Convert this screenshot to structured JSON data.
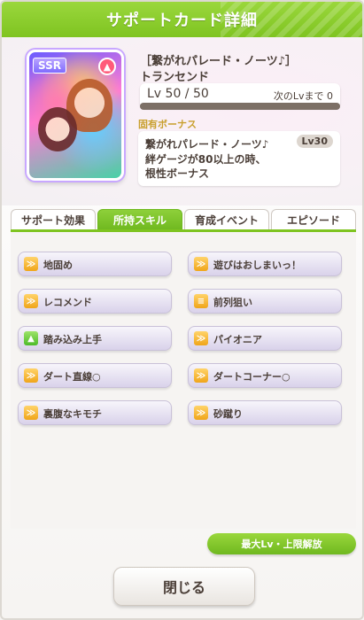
{
  "header": {
    "title": "サポートカード詳細"
  },
  "card": {
    "rarity": "SSR",
    "type_icon": "fire-icon"
  },
  "name": {
    "line1": "［繋がれパレード・ノーツ♪］",
    "line2": "トランセンド"
  },
  "level": {
    "text": "Lv 50 / 50",
    "next": "次のLvまで 0"
  },
  "bonus": {
    "label": "固有ボーナス",
    "title": "繋がれパレード・ノーツ♪",
    "lv": "Lv30",
    "desc1": "絆ゲージが80以上の時、",
    "desc2": "根性ボーナス"
  },
  "tabs": [
    {
      "label": "サポート効果"
    },
    {
      "label": "所持スキル"
    },
    {
      "label": "育成イベント"
    },
    {
      "label": "エピソード"
    }
  ],
  "skills": [
    {
      "label": "地固め",
      "icon": "orange"
    },
    {
      "label": "遊びはおしまいっ！",
      "icon": "orange"
    },
    {
      "label": "レコメンド",
      "icon": "orange"
    },
    {
      "label": "前列狙い",
      "icon": "orange"
    },
    {
      "label": "踏み込み上手",
      "icon": "green"
    },
    {
      "label": "パイオニア",
      "icon": "orange"
    },
    {
      "label": "ダート直線○",
      "icon": "orange"
    },
    {
      "label": "ダートコーナー○",
      "icon": "orange"
    },
    {
      "label": "裏腹なキモチ",
      "icon": "orange"
    },
    {
      "label": "砂蹴り",
      "icon": "orange"
    }
  ],
  "buttons": {
    "max": "最大Lv・上限解放",
    "close": "閉じる"
  }
}
